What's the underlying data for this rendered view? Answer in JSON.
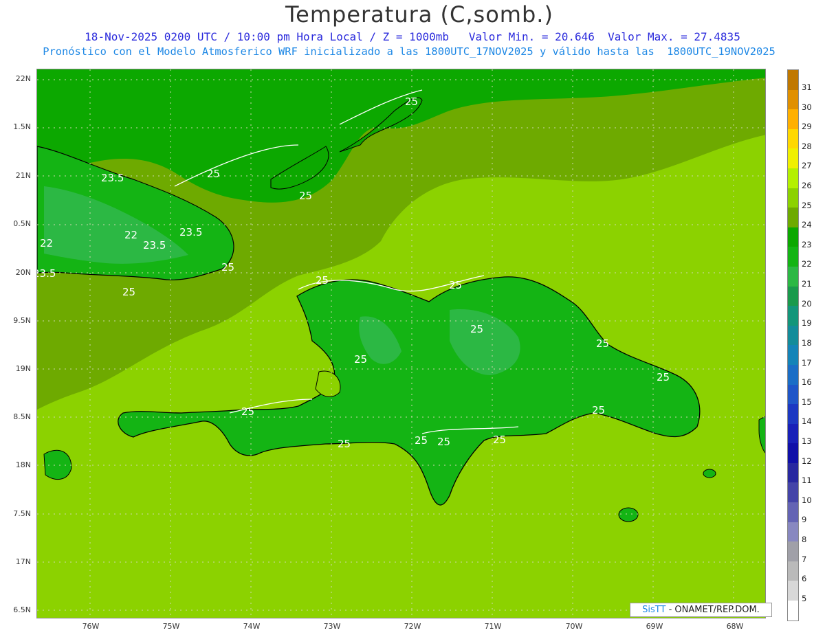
{
  "header": {
    "title": "Temperatura (C,somb.)",
    "line1": "18-Nov-2025 0200 UTC / 10:00 pm Hora Local / Z = 1000mb   Valor Min. = 20.646  Valor Max. = 27.4835",
    "line2": "Pronóstico con el Modelo Atmosferico WRF inicializado a las 1800UTC_17NOV2025 y válido hasta las  1800UTC_19NOV2025"
  },
  "axes": {
    "lat_labels": [
      "22N",
      "1.5N",
      "21N",
      "0.5N",
      "20N",
      "9.5N",
      "19N",
      "8.5N",
      "18N",
      "7.5N",
      "17N",
      "6.5N"
    ],
    "lon_labels": [
      "76W",
      "75W",
      "74W",
      "73W",
      "72W",
      "71W",
      "70W",
      "69W",
      "68W"
    ]
  },
  "contour_labels": [
    "25",
    "25",
    "25",
    "23.5",
    "22",
    "22",
    "23.5",
    "23.5",
    "25",
    "23.5",
    "25",
    "25",
    "25",
    "25",
    "25",
    "25",
    "25",
    "25",
    "25",
    "25",
    "25",
    "25",
    "25"
  ],
  "colorbar": {
    "values": [
      "31",
      "30",
      "29",
      "28",
      "27",
      "26",
      "25",
      "24",
      "23",
      "22",
      "21",
      "20",
      "19",
      "18",
      "17",
      "16",
      "15",
      "14",
      "13",
      "12",
      "11",
      "10",
      "9",
      "8",
      "7",
      "6",
      "5"
    ],
    "colors": [
      "#c07800",
      "#e09000",
      "#ffb000",
      "#ffd800",
      "#f0f000",
      "#b4f000",
      "#8cd200",
      "#6eaa00",
      "#0ca800",
      "#14b414",
      "#2cb844",
      "#1a9a4c",
      "#13967a",
      "#138c9a",
      "#1484b8",
      "#1b6ec6",
      "#1f56c8",
      "#1c38c2",
      "#1820b8",
      "#1010a8",
      "#2828a0",
      "#4444a8",
      "#6464b4",
      "#8888c0",
      "#a0a0a8",
      "#bababa",
      "#d8d8d8",
      "#ffffff"
    ]
  },
  "credit": {
    "brand": "SisTT",
    "text": " - ONAMET/REP.DOM."
  }
}
